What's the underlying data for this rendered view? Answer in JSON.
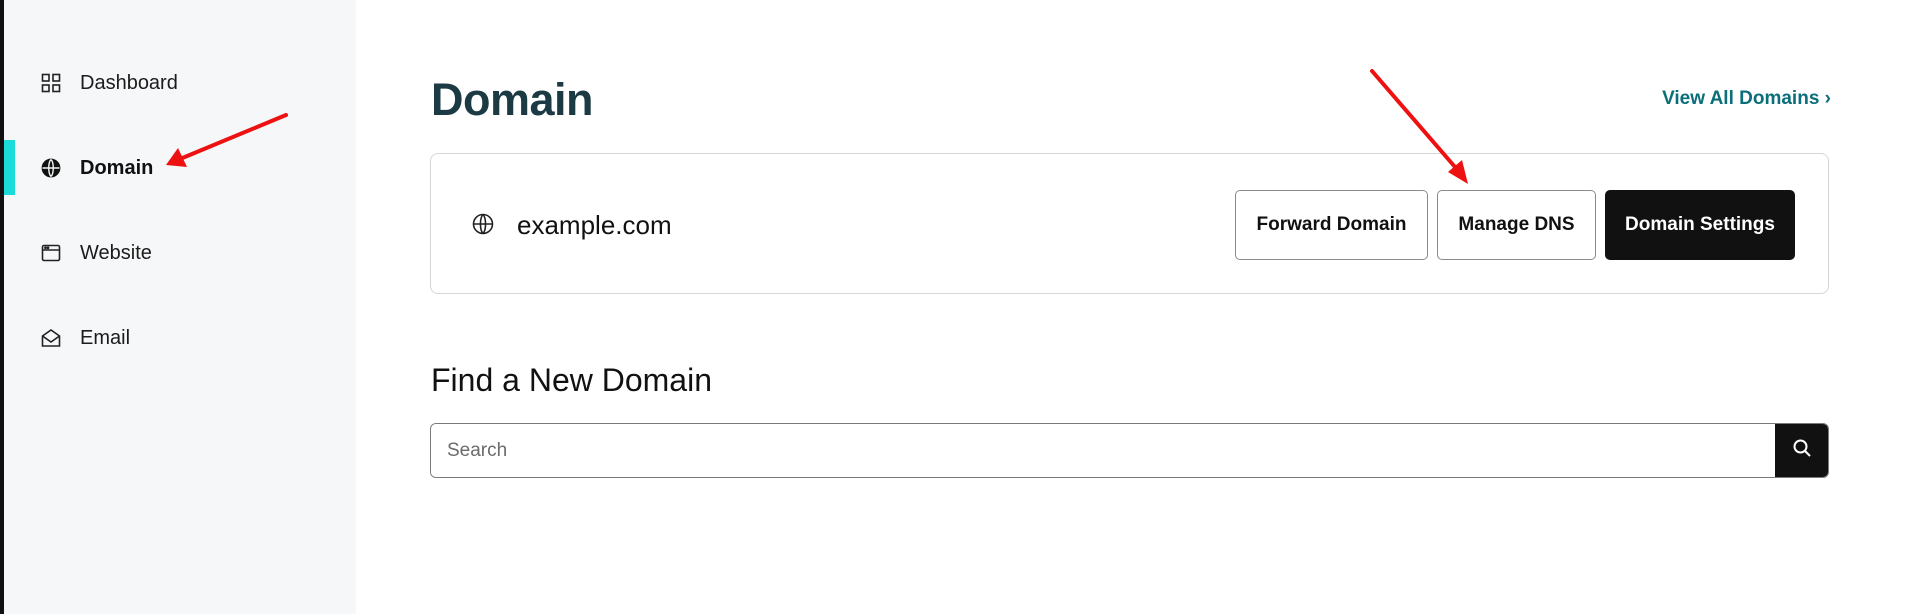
{
  "sidebar": {
    "items": [
      {
        "label": "Dashboard",
        "icon": "grid-icon"
      },
      {
        "label": "Domain",
        "icon": "globe-icon",
        "active": true
      },
      {
        "label": "Website",
        "icon": "browser-window-icon"
      },
      {
        "label": "Email",
        "icon": "envelope-icon"
      }
    ]
  },
  "main": {
    "title": "Domain",
    "view_all_label": "View All Domains ›",
    "domain_card": {
      "domain": "example.com",
      "buttons": {
        "forward": "Forward Domain",
        "dns": "Manage DNS",
        "settings": "Domain Settings"
      }
    },
    "find_section": {
      "title": "Find a New Domain",
      "search_placeholder": "Search"
    }
  },
  "colors": {
    "active_accent": "#1bdbdb",
    "title": "#1c3a44",
    "link": "#0a6f7a",
    "primary_button": "#111111",
    "annotation_arrow": "#ee1111"
  }
}
